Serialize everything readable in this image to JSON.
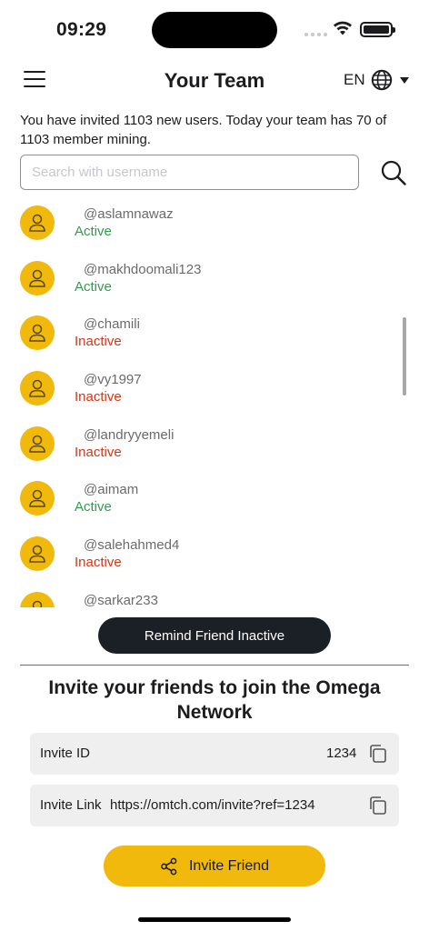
{
  "status_bar": {
    "time": "09:29"
  },
  "header": {
    "title": "Your Team",
    "language": "EN"
  },
  "info_text": "You have invited 1103 new users. Today your team has 70 of 1103 member mining.",
  "search": {
    "placeholder": "Search with username",
    "value": ""
  },
  "members": [
    {
      "username": "@aslamnawaz",
      "status": "Active"
    },
    {
      "username": "@makhdoomali123",
      "status": "Active"
    },
    {
      "username": "@chamili",
      "status": "Inactive"
    },
    {
      "username": "@vy1997",
      "status": "Inactive"
    },
    {
      "username": "@landryyemeli",
      "status": "Inactive"
    },
    {
      "username": "@aimam",
      "status": "Active"
    },
    {
      "username": "@salehahmed4",
      "status": "Inactive"
    },
    {
      "username": "@sarkar233",
      "status": ""
    }
  ],
  "remind_button": "Remind Friend Inactive",
  "invite": {
    "title": "Invite your friends to join the Omega Network",
    "id_label": "Invite ID",
    "id_value": "1234",
    "link_label": "Invite Link",
    "link_value": "https://omtch.com/invite?ref=1234",
    "button_label": "Invite Friend"
  },
  "colors": {
    "accent": "#f0b90b",
    "active": "#2e9e4d",
    "inactive": "#d0381a",
    "dark_button": "#1b2027"
  },
  "icons": [
    "menu-icon",
    "globe-icon",
    "chevron-down-icon",
    "search-icon",
    "user-icon",
    "copy-icon",
    "share-icon",
    "wifi-icon",
    "battery-icon"
  ]
}
